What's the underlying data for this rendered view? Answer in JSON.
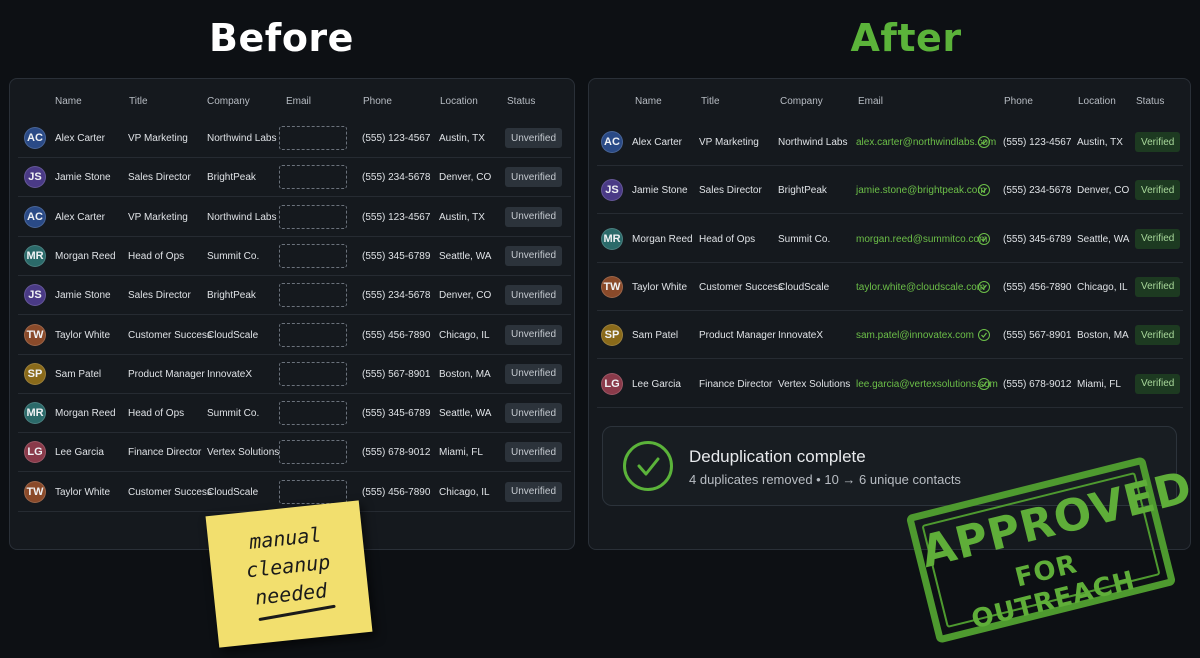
{
  "before": {
    "heading": "Before",
    "columns": [
      "Name",
      "Title",
      "Company",
      "Email",
      "Phone",
      "Location",
      "Status"
    ],
    "rows": [
      {
        "initials": "AC",
        "avatar_color": "#2a4a86",
        "name": "Alex Carter",
        "title": "VP Marketing",
        "company": "Northwind Labs",
        "phone": "(555) 123-4567",
        "location": "Austin, TX",
        "status": "Unverified"
      },
      {
        "initials": "JS",
        "avatar_color": "#4a3a86",
        "name": "Jamie Stone",
        "title": "Sales Director",
        "company": "BrightPeak",
        "phone": "(555) 234-5678",
        "location": "Denver, CO",
        "status": "Unverified"
      },
      {
        "initials": "AC",
        "avatar_color": "#2a4a86",
        "name": "Alex Carter",
        "title": "VP Marketing",
        "company": "Northwind Labs",
        "phone": "(555) 123-4567",
        "location": "Austin, TX",
        "status": "Unverified"
      },
      {
        "initials": "MR",
        "avatar_color": "#2b6a6a",
        "name": "Morgan Reed",
        "title": "Head of Ops",
        "company": "Summit Co.",
        "phone": "(555) 345-6789",
        "location": "Seattle, WA",
        "status": "Unverified"
      },
      {
        "initials": "JS",
        "avatar_color": "#4a3a86",
        "name": "Jamie Stone",
        "title": "Sales Director",
        "company": "BrightPeak",
        "phone": "(555) 234-5678",
        "location": "Denver, CO",
        "status": "Unverified"
      },
      {
        "initials": "TW",
        "avatar_color": "#8a4a2a",
        "name": "Taylor White",
        "title": "Customer Success",
        "company": "CloudScale",
        "phone": "(555) 456-7890",
        "location": "Chicago, IL",
        "status": "Unverified"
      },
      {
        "initials": "SP",
        "avatar_color": "#8a6a1a",
        "name": "Sam Patel",
        "title": "Product Manager",
        "company": "InnovateX",
        "phone": "(555) 567-8901",
        "location": "Boston, MA",
        "status": "Unverified"
      },
      {
        "initials": "MR",
        "avatar_color": "#2b6a6a",
        "name": "Morgan Reed",
        "title": "Head of Ops",
        "company": "Summit Co.",
        "phone": "(555) 345-6789",
        "location": "Seattle, WA",
        "status": "Unverified"
      },
      {
        "initials": "LG",
        "avatar_color": "#8a3a4a",
        "name": "Lee Garcia",
        "title": "Finance Director",
        "company": "Vertex Solutions",
        "phone": "(555) 678-9012",
        "location": "Miami, FL",
        "status": "Unverified"
      },
      {
        "initials": "TW",
        "avatar_color": "#8a4a2a",
        "name": "Taylor White",
        "title": "Customer Success",
        "company": "CloudScale",
        "phone": "(555) 456-7890",
        "location": "Chicago, IL",
        "status": "Unverified"
      }
    ],
    "sticky_note": [
      "manual",
      "cleanup",
      "needed"
    ]
  },
  "after": {
    "heading": "After",
    "columns": [
      "Name",
      "Title",
      "Company",
      "Email",
      "Phone",
      "Location",
      "Status"
    ],
    "rows": [
      {
        "initials": "AC",
        "avatar_color": "#2a4a86",
        "name": "Alex Carter",
        "title": "VP Marketing",
        "company": "Northwind Labs",
        "email": "alex.carter@northwindlabs.com",
        "phone": "(555) 123-4567",
        "location": "Austin, TX",
        "status": "Verified"
      },
      {
        "initials": "JS",
        "avatar_color": "#4a3a86",
        "name": "Jamie Stone",
        "title": "Sales Director",
        "company": "BrightPeak",
        "email": "jamie.stone@brightpeak.com",
        "phone": "(555) 234-5678",
        "location": "Denver, CO",
        "status": "Verified"
      },
      {
        "initials": "MR",
        "avatar_color": "#2b6a6a",
        "name": "Morgan Reed",
        "title": "Head of Ops",
        "company": "Summit Co.",
        "email": "morgan.reed@summitco.com",
        "phone": "(555) 345-6789",
        "location": "Seattle, WA",
        "status": "Verified"
      },
      {
        "initials": "TW",
        "avatar_color": "#8a4a2a",
        "name": "Taylor White",
        "title": "Customer Success",
        "company": "CloudScale",
        "email": "taylor.white@cloudscale.com",
        "phone": "(555) 456-7890",
        "location": "Chicago, IL",
        "status": "Verified"
      },
      {
        "initials": "SP",
        "avatar_color": "#8a6a1a",
        "name": "Sam Patel",
        "title": "Product Manager",
        "company": "InnovateX",
        "email": "sam.patel@innovatex.com",
        "phone": "(555) 567-8901",
        "location": "Boston, MA",
        "status": "Verified"
      },
      {
        "initials": "LG",
        "avatar_color": "#8a3a4a",
        "name": "Lee Garcia",
        "title": "Finance Director",
        "company": "Vertex Solutions",
        "email": "lee.garcia@vertexsolutions.com",
        "phone": "(555) 678-9012",
        "location": "Miami, FL",
        "status": "Verified"
      }
    ],
    "summary": {
      "title": "Deduplication complete",
      "subtitle": "4 duplicates removed • 10 → 6 unique contacts"
    },
    "stamp": {
      "line1": "APPROVED",
      "line2": "FOR OUTREACH"
    }
  }
}
